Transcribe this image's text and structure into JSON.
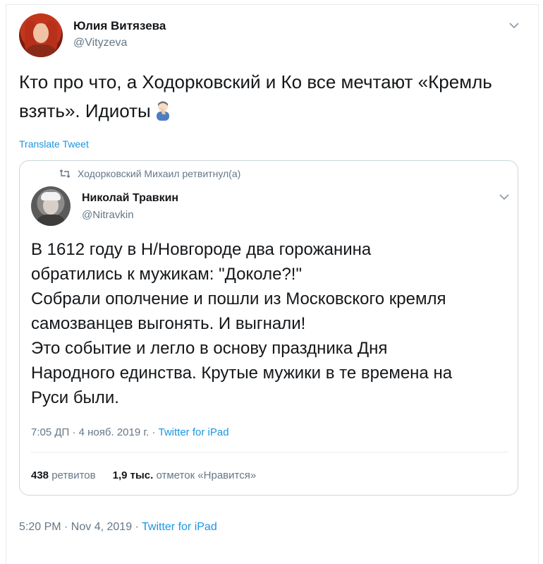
{
  "tweet": {
    "author_name": "Юлия Витязева",
    "author_handle": "@Vityzeva",
    "text": "Кто про что, а Ходорковский и Ко все мечтают «Кремль взять». Идиоты",
    "translate_label": "Translate Tweet",
    "time": "5:20 PM · Nov 4, 2019 · ",
    "source": "Twitter for iPad",
    "emoji_icon": "person-facepalming-emoji"
  },
  "quoted": {
    "retweet_line": "Ходорковский Михаил ретвитнул(а)",
    "author_name": "Николай Травкин",
    "author_handle": "@Nitravkin",
    "text_lines": [
      "В 1612 году в Н/Новгороде два горожанина",
      "обратились к мужикам: \"Доколе?!\"",
      "Собрали ополчение и пошли из Московского кремля",
      "самозванцев выгонять. И выгнали!",
      "Это событие и легло в основу праздника Дня",
      "Народного единства. Крутые мужики в те времена на",
      "Руси были."
    ],
    "time": "7:05 ДП · 4 нояб. 2019 г. · ",
    "source": "Twitter for iPad",
    "retweets_count": "438",
    "retweets_label": "ретвитов",
    "likes_count": "1,9 тыс.",
    "likes_label": "отметок «Нравится»"
  },
  "colors": {
    "text": "#14171a",
    "secondary": "#657786",
    "link": "#1b95e0",
    "border": "#ccd6dd"
  }
}
